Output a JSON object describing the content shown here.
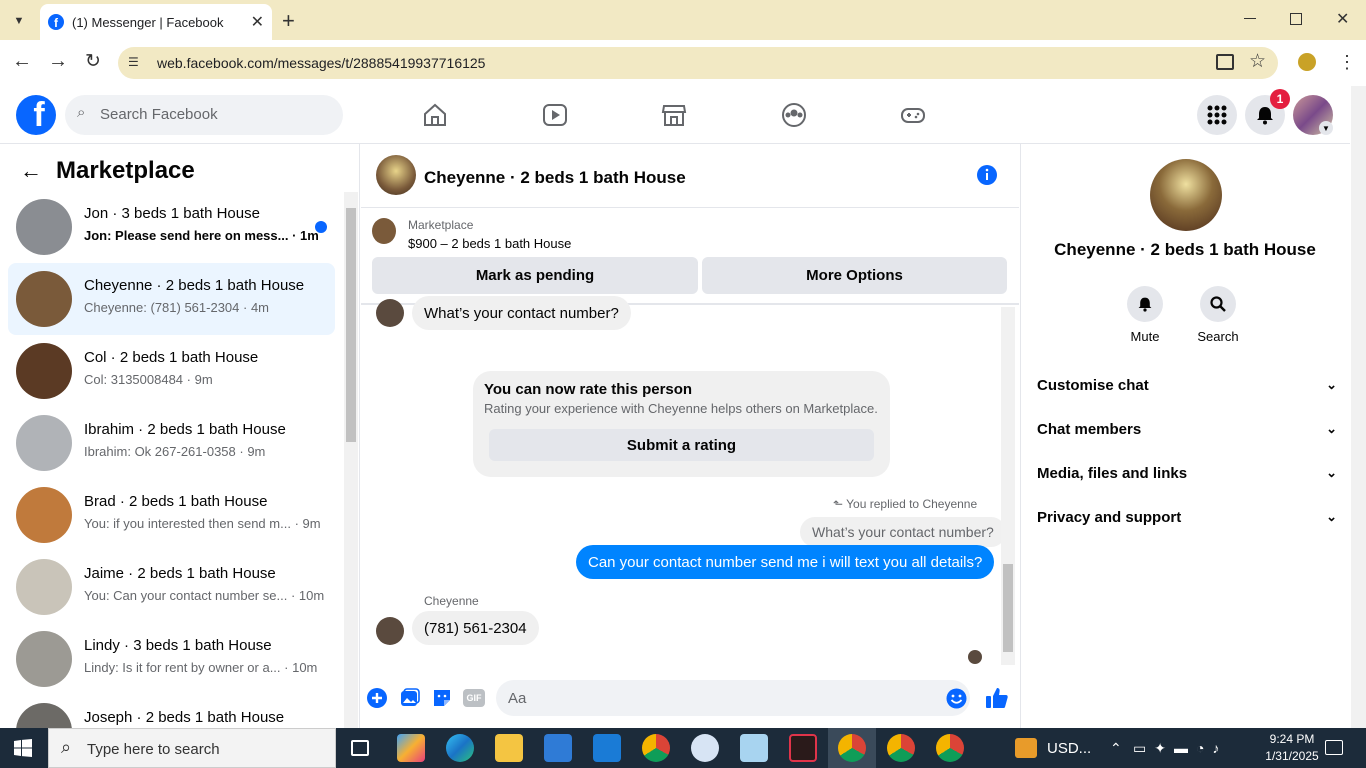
{
  "browser": {
    "tab_title": "(1) Messenger | Facebook",
    "url": "web.facebook.com/messages/t/28885419937716125"
  },
  "fb_header": {
    "search_placeholder": "Search Facebook",
    "notification_count": "1"
  },
  "left_pane": {
    "title": "Marketplace",
    "conversations": [
      {
        "name": "Jon · 3 beds 1 bath House",
        "preview": "Jon: Please send here on mess...",
        "time": "· 1m",
        "unread": true,
        "selected": false,
        "thumb": "#8a8d92"
      },
      {
        "name": "Cheyenne · 2 beds 1 bath House",
        "preview": "Cheyenne: (781) 561-2304",
        "time": "· 4m",
        "unread": false,
        "selected": true,
        "thumb": "#7a5a3a"
      },
      {
        "name": "Col · 2 beds 1 bath House",
        "preview": "Col: 3135008484",
        "time": "· 9m",
        "unread": false,
        "selected": false,
        "thumb": "#5b3a24"
      },
      {
        "name": "Ibrahim · 2 beds 1 bath House",
        "preview": "Ibrahim: Ok 267-261-0358",
        "time": "· 9m",
        "unread": false,
        "selected": false,
        "thumb": "#b0b3b7"
      },
      {
        "name": "Brad · 2 beds 1 bath House",
        "preview": "You: if you interested then send m...",
        "time": "· 9m",
        "unread": false,
        "selected": false,
        "thumb": "#c07a3c"
      },
      {
        "name": "Jaime · 2 beds 1 bath House",
        "preview": "You: Can your contact number se...",
        "time": "· 10m",
        "unread": false,
        "selected": false,
        "thumb": "#c9c4b9"
      },
      {
        "name": "Lindy · 3 beds 1 bath House",
        "preview": "Lindy: Is it for rent by owner or a...",
        "time": "· 10m",
        "unread": false,
        "selected": false,
        "thumb": "#9c9a94"
      },
      {
        "name": "Joseph · 2 beds 1 bath House",
        "preview": "",
        "time": "",
        "unread": false,
        "selected": false,
        "thumb": "#6c6a66"
      }
    ]
  },
  "chat": {
    "title": "Cheyenne · 2 beds 1 bath House",
    "listing_source": "Marketplace",
    "listing_price": "$900 – 2 beds 1 bath House",
    "mark_pending": "Mark as pending",
    "more_options": "More Options",
    "msg_in_1": "What’s your contact number?",
    "rate_title": "You can now rate this person",
    "rate_sub": "Rating your experience with Cheyenne helps others on Marketplace.",
    "rate_button": "Submit a rating",
    "replied_note": "You replied to Cheyenne",
    "quoted": "What’s your contact number?",
    "msg_out": "Can your contact number send me i will text you all details?",
    "sender_name": "Cheyenne",
    "msg_in_2": "(781) 561-2304",
    "composer_placeholder": "Aa"
  },
  "right_pane": {
    "name": "Cheyenne · 2 beds 1 bath House",
    "mute_label": "Mute",
    "search_label": "Search",
    "sections": [
      "Customise chat",
      "Chat members",
      "Media, files and links",
      "Privacy and support"
    ]
  },
  "taskbar": {
    "search_placeholder": "Type here to search",
    "currency": "USD...",
    "time": "9:24 PM",
    "date": "1/31/2025"
  },
  "colors": {
    "fb_blue": "#0866ff",
    "messenger_blue": "#0084ff",
    "badge_red": "#e41e3f"
  }
}
